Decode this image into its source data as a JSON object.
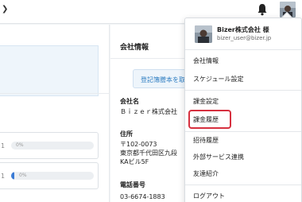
{
  "header": {
    "collapse_icon": "chevron-right-icon",
    "bell_icon": "bell-icon",
    "avatar_icon": "user-avatar"
  },
  "left_panel": {
    "rows": [
      {
        "number": "1",
        "bar_label": "0%",
        "progress": 0
      },
      {
        "number": "1",
        "bar_label": "0%",
        "progress": 0.04
      }
    ],
    "accent": "#3a7bd5"
  },
  "company_panel": {
    "title": "会社情報",
    "register_button": "登記簿謄本を取",
    "company_name_label": "会社名",
    "company_name_value": "Ｂｉｚｅｒ株式会社",
    "address_label": "住所",
    "address_lines": [
      "〒102-0073",
      "東京都千代田区九段",
      "KAビル5F"
    ],
    "phone_label": "電話番号",
    "phone_value": "03-6674-1883"
  },
  "dropdown": {
    "user_name": "Bizer株式会社 様",
    "user_email": "bizer_user@bizer.jp",
    "items": [
      "会社情報",
      "スケジュール設定",
      "課金設定",
      "課金履歴",
      "招待履歴",
      "外部サービス連携",
      "友達紹介",
      "ログアウト"
    ],
    "highlight_color": "#d6303f"
  }
}
